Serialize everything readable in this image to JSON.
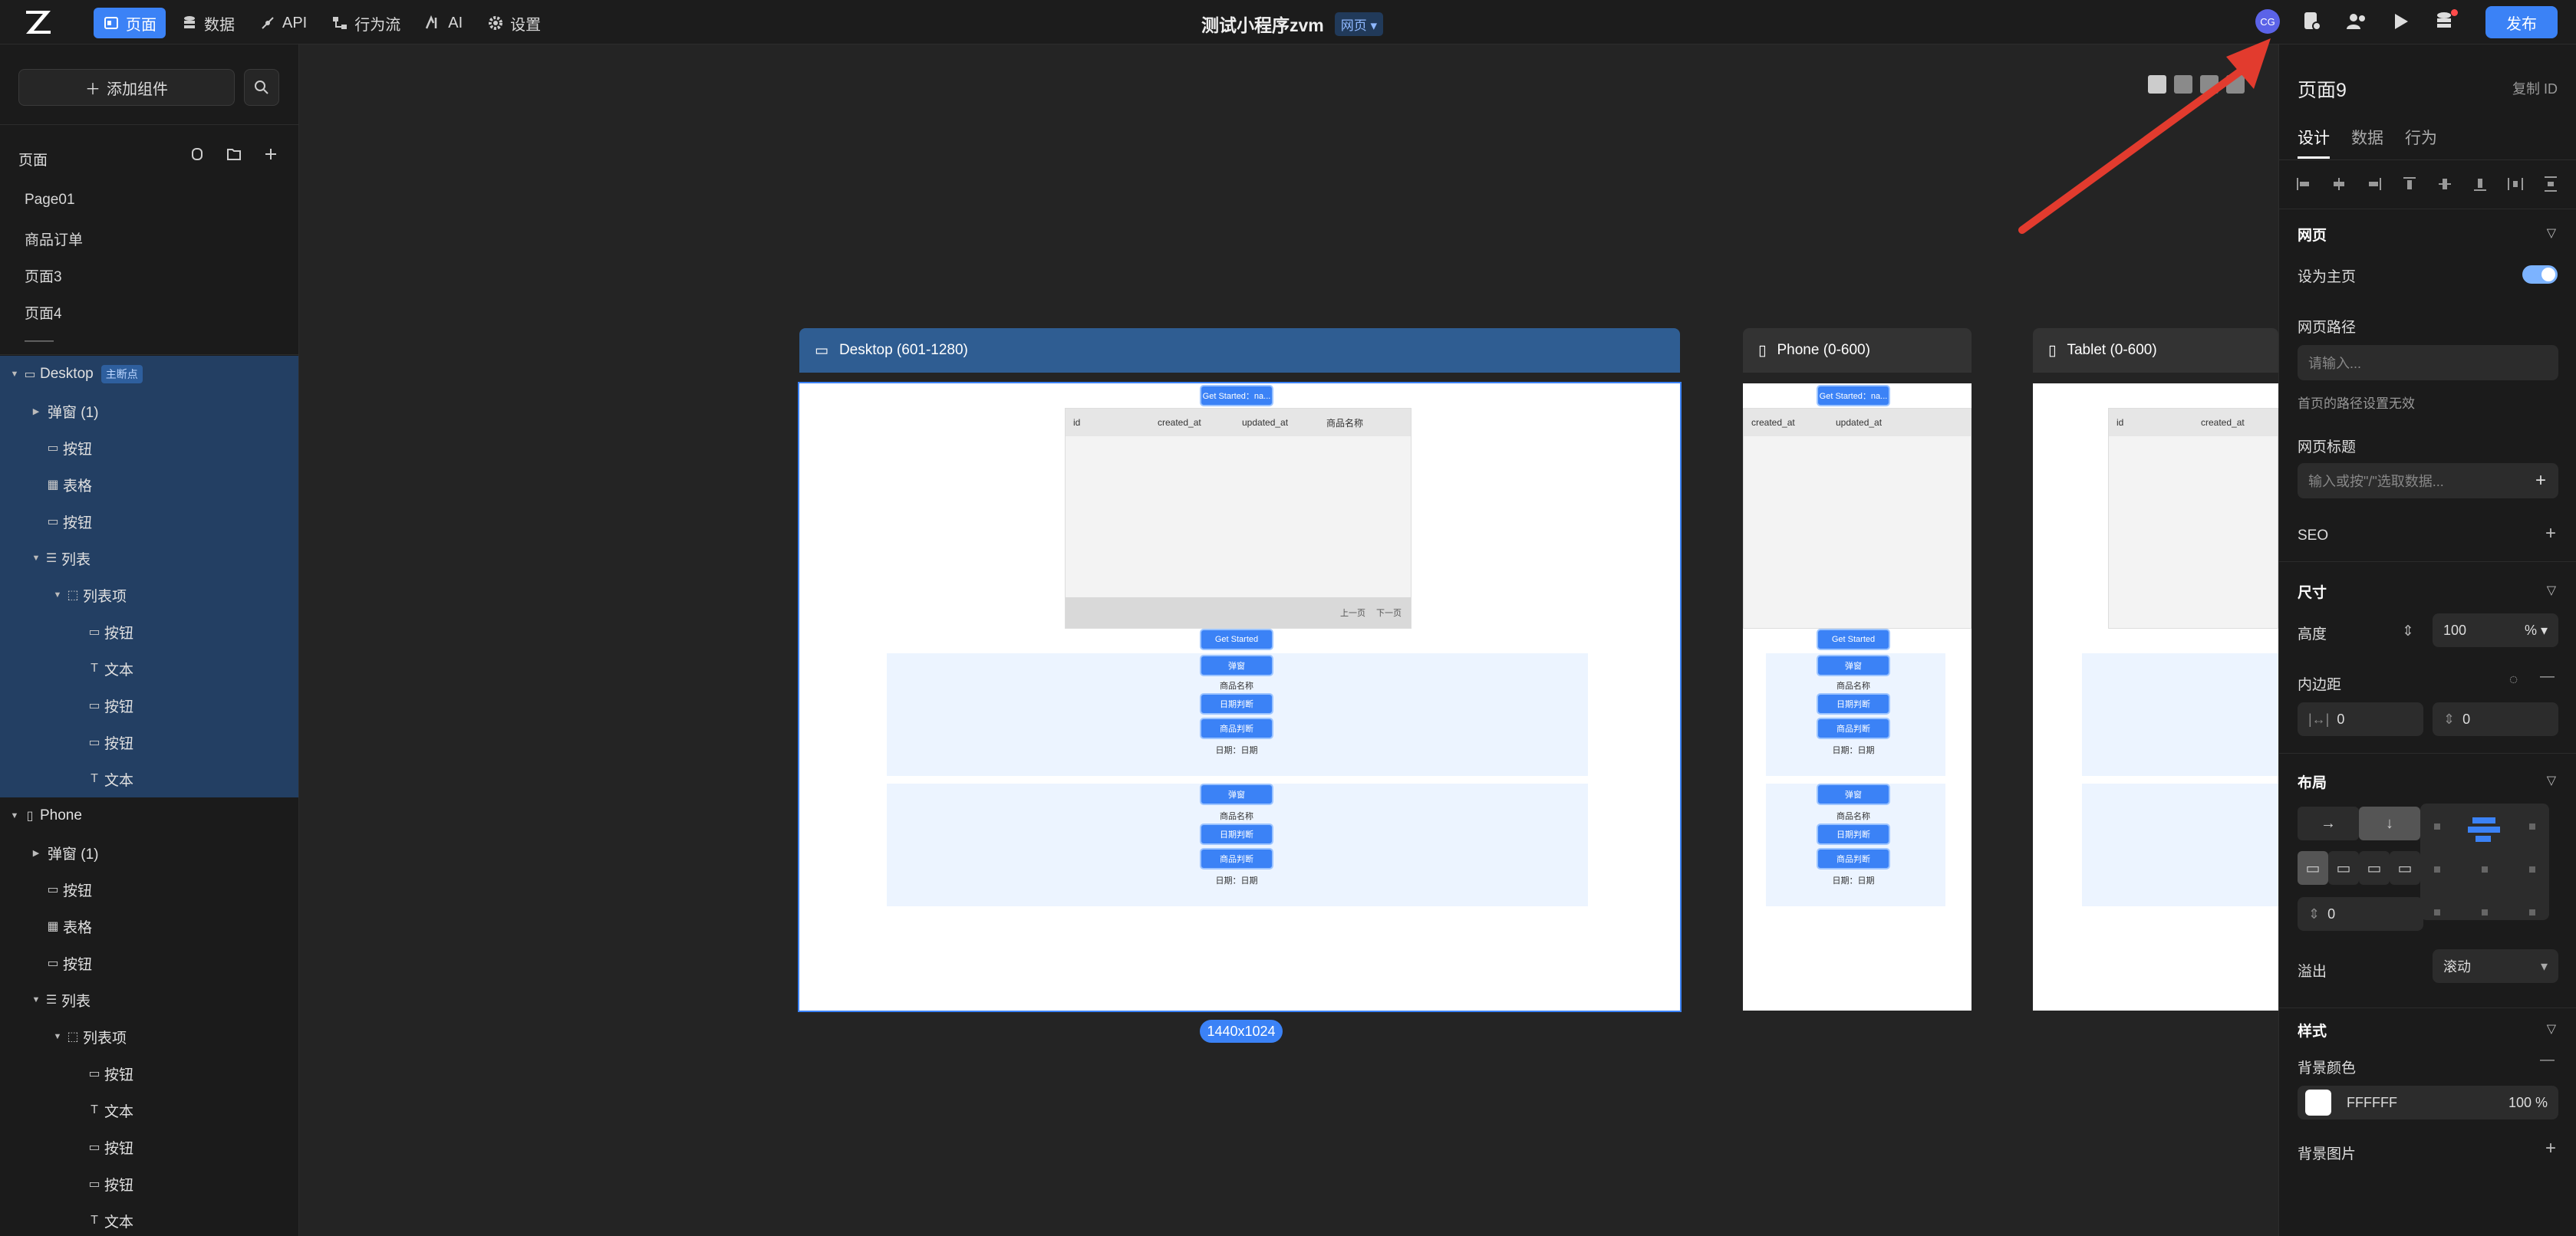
{
  "topbar": {
    "nav": [
      {
        "label": "页面",
        "icon": "pages-icon"
      },
      {
        "label": "数据",
        "icon": "database-icon"
      },
      {
        "label": "API",
        "icon": "api-icon"
      },
      {
        "label": "行为流",
        "icon": "flow-icon"
      },
      {
        "label": "AI",
        "icon": "ai-icon"
      },
      {
        "label": "设置",
        "icon": "gear-icon"
      }
    ],
    "app_title": "测试小程序zvm",
    "app_type": "网页",
    "avatar_text": "CG",
    "publish_label": "发布"
  },
  "left": {
    "add_component": "添加组件",
    "pages_title": "页面",
    "pages": [
      "Page01",
      "商品订单",
      "页面3",
      "页面4",
      "——"
    ],
    "desktop_tree": [
      {
        "label": "Desktop",
        "tag": "主断点",
        "icon": "monitor-icon"
      },
      {
        "label": "弹窗 (1)"
      },
      {
        "label": "按钮"
      },
      {
        "label": "表格"
      },
      {
        "label": "按钮"
      },
      {
        "label": "列表"
      },
      {
        "label": "列表项"
      },
      {
        "label": "按钮"
      },
      {
        "label": "文本"
      },
      {
        "label": "按钮"
      },
      {
        "label": "按钮"
      },
      {
        "label": "文本"
      }
    ],
    "phone_tree": [
      {
        "label": "Phone"
      },
      {
        "label": "弹窗 (1)"
      },
      {
        "label": "按钮"
      },
      {
        "label": "表格"
      },
      {
        "label": "按钮"
      },
      {
        "label": "列表"
      },
      {
        "label": "列表项"
      },
      {
        "label": "按钮"
      },
      {
        "label": "文本"
      },
      {
        "label": "按钮"
      },
      {
        "label": "按钮"
      },
      {
        "label": "文本"
      }
    ]
  },
  "canvas": {
    "frames": {
      "desktop": "Desktop (601-1280)",
      "phone": "Phone (0-600)",
      "tablet": "Tablet (0-600)"
    },
    "size_label": "1440x1024",
    "table_columns": [
      "id",
      "created_at",
      "updated_at",
      "商品名称"
    ],
    "pager_prev": "上一页",
    "pager_next": "下一页",
    "top_button": "Get Started：na...",
    "get_started": "Get Started",
    "popup_btn": "弹窗",
    "product_name": "商品名称",
    "date_judge": "日期判断",
    "product_judge": "商品判断",
    "date_text": "日期：日期"
  },
  "right": {
    "page_title": "页面9",
    "copy_id": "复制 ID",
    "tabs": [
      "设计",
      "数据",
      "行为"
    ],
    "web_section": "网页",
    "set_home": "设为主页",
    "home_toggle": true,
    "web_path_label": "网页路径",
    "web_path_placeholder": "请输入...",
    "path_note": "首页的路径设置无效",
    "web_title_label": "网页标题",
    "web_title_placeholder": "输入或按\"/\"选取数据...",
    "seo": "SEO",
    "size_section": "尺寸",
    "height_label": "高度",
    "height_value": "100",
    "height_unit": "%",
    "padding_label": "内边距",
    "padding_x": "0",
    "padding_y": "0",
    "layout_section": "布局",
    "gap_value": "0",
    "overflow_label": "溢出",
    "overflow_value": "滚动",
    "style_section": "样式",
    "bg_color_label": "背景颜色",
    "bg_color_hex": "FFFFFF",
    "bg_opacity": "100 %",
    "bg_image_label": "背景图片"
  },
  "colors": {
    "accent": "#3b82f6",
    "selection": "#233f63",
    "annotation_arrow": "#e23b2e"
  }
}
